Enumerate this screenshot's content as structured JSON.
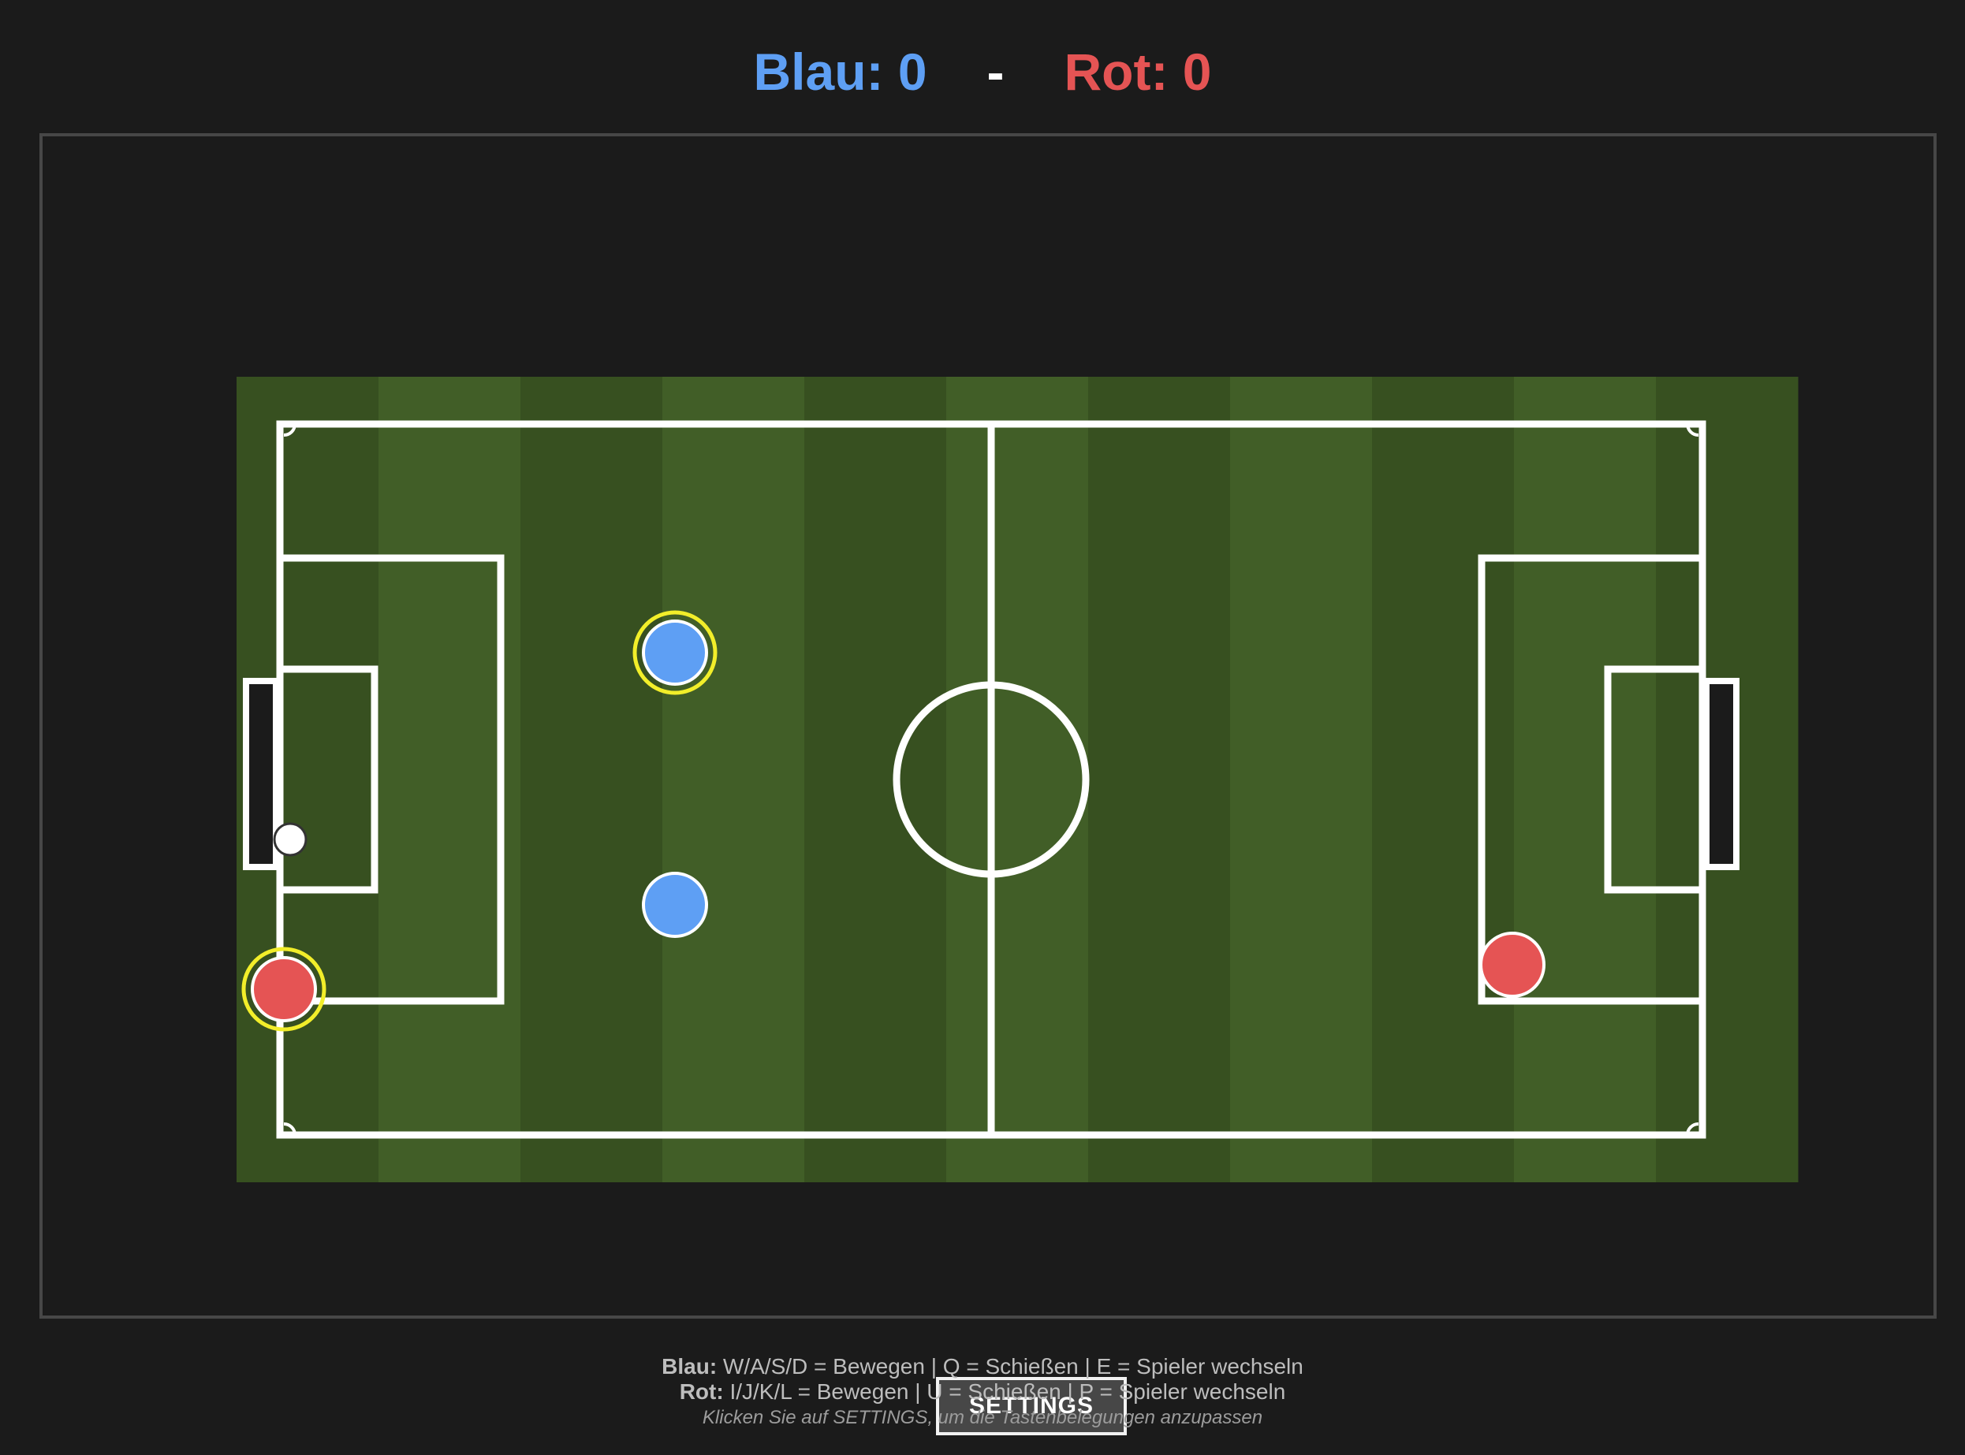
{
  "score": {
    "blue_label": "Blau: 0",
    "separator": "-",
    "red_label": "Rot: 0",
    "blue_value": 0,
    "red_value": 0
  },
  "colors": {
    "blue_team": "#5e9ff4",
    "red_team": "#e55454",
    "pitch_dark": "#375020",
    "pitch_light": "#415e27",
    "lines": "#ffffff",
    "active_ring": "#f2ee2a",
    "ball": "#ffffff"
  },
  "settings_button": {
    "label": "SETTINGS"
  },
  "controls": {
    "blue_team": "Blau:",
    "blue_keys": " W/A/S/D = Bewegen | Q = Schießen | E = Spieler wechseln",
    "red_team": "Rot:",
    "red_keys": " I/J/K/L = Bewegen | U = Schießen | P = Spieler wechseln",
    "hint": "Klicken Sie auf SETTINGS, um die Tastenbelegungen anzupassen"
  },
  "players": [
    {
      "team": "blue",
      "active": true
    },
    {
      "team": "blue",
      "active": false
    },
    {
      "team": "red",
      "active": true
    },
    {
      "team": "red",
      "active": false
    }
  ]
}
